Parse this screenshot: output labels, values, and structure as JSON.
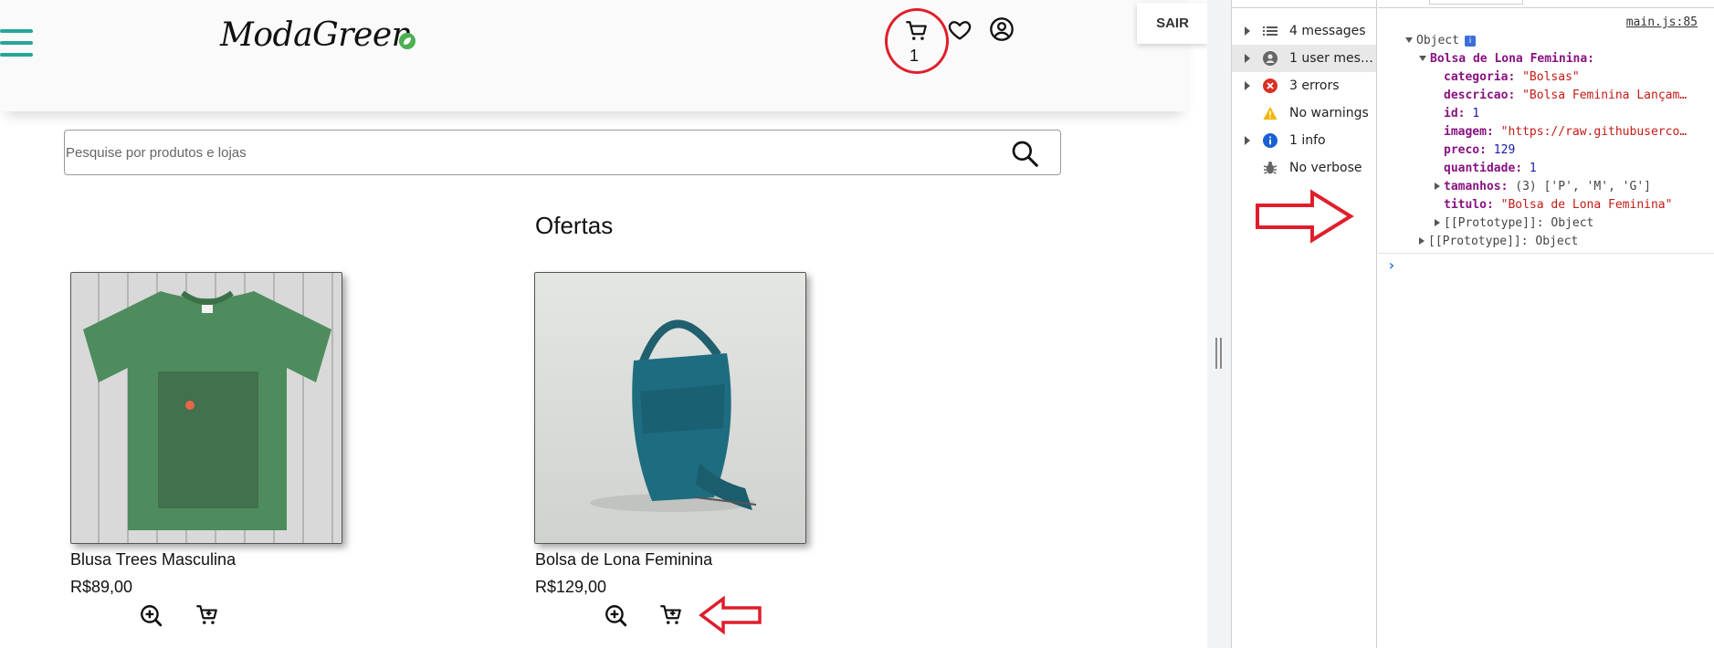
{
  "app": {
    "logo_text": "ModaGreen",
    "cart_count": "1",
    "logout_label": "SAIR",
    "search": {
      "placeholder": "Pesquise por produtos e lojas",
      "value": ""
    },
    "section_title": "Ofertas",
    "products": [
      {
        "name": "Blusa Trees Masculina",
        "price": "R$89,00"
      },
      {
        "name": "Bolsa de Lona Feminina",
        "price": "R$129,00"
      }
    ],
    "colors": {
      "accent": "#26a69a",
      "annotation": "#e01e2b"
    }
  },
  "devtools": {
    "sidebar": [
      {
        "label": "4 messages",
        "icon": "list-icon"
      },
      {
        "label": "1 user mess...",
        "icon": "user-icon",
        "selected": true
      },
      {
        "label": "3 errors",
        "icon": "error-icon"
      },
      {
        "label": "No warnings",
        "icon": "warning-icon"
      },
      {
        "label": "1 info",
        "icon": "info-icon"
      },
      {
        "label": "No verbose",
        "icon": "bug-icon"
      }
    ],
    "source_link": "main.js:85",
    "object_label": "Object",
    "info_badge": "i",
    "key_label": "Bolsa de Lona Feminina:",
    "fields": [
      {
        "key": "categoria:",
        "value": "\"Bolsas\""
      },
      {
        "key": "descricao:",
        "value": "\"Bolsa Feminina Lançam…"
      },
      {
        "key": "id:",
        "value": "1"
      },
      {
        "key": "imagem:",
        "value": "\"https://raw.githubuserco…"
      },
      {
        "key": "preco:",
        "value": "129"
      },
      {
        "key": "quantidade:",
        "value": "1"
      },
      {
        "key": "tamanhos:",
        "value": "(3) ['P', 'M', 'G']"
      },
      {
        "key": "titulo:",
        "value": "\"Bolsa de Lona Feminina\""
      }
    ],
    "proto_inner": "[[Prototype]]: Object",
    "proto_outer": "[[Prototype]]: Object",
    "prompt": "›"
  }
}
